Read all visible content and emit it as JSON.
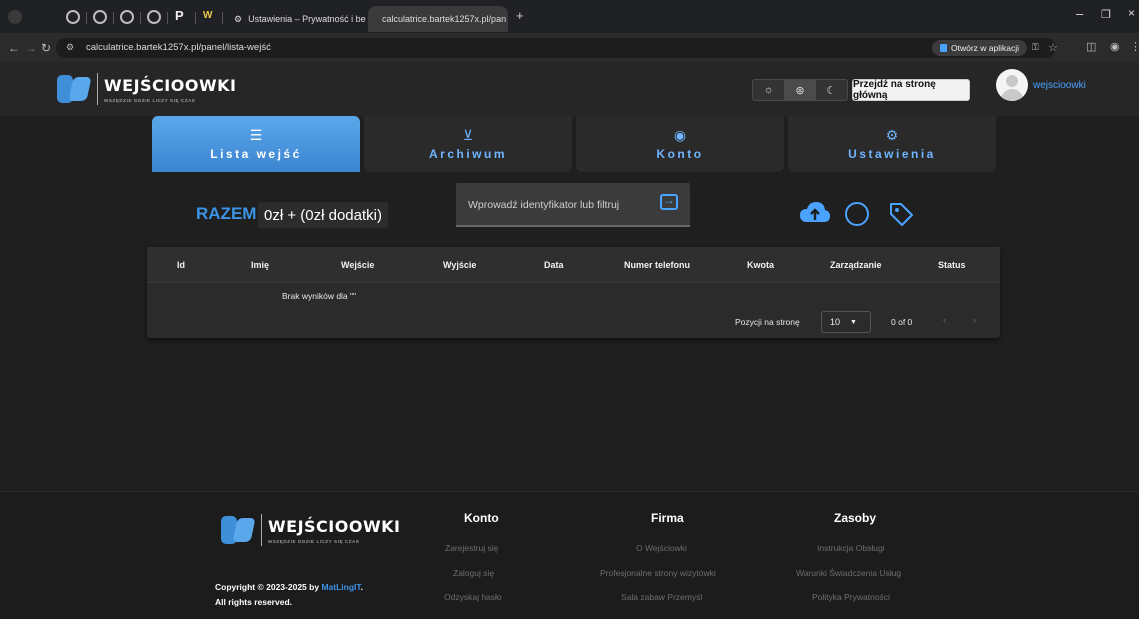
{
  "browser": {
    "tabs": [
      {
        "title": "Ustawienia – Prywatność i bezp",
        "active": false
      },
      {
        "title": "calculatrice.bartek1257x.pl/pan",
        "active": true
      }
    ],
    "url": "calculatrice.bartek1257x.pl/panel/lista-wejść",
    "open_in_app": "Otwórz w aplikacji"
  },
  "header": {
    "logo_title": "WEJŚCIOOWKI",
    "logo_subtitle": "WSZĘDZIE GDZIE LICZY SIĘ CZAS",
    "home_button": "Przejdź na stronę główną",
    "username": "wejscioowki",
    "theme_active": "system"
  },
  "nav_tabs": [
    {
      "label": "Lista wejść",
      "icon": "list-icon",
      "active": true
    },
    {
      "label": "Archiwum",
      "icon": "archive-icon",
      "active": false
    },
    {
      "label": "Konto",
      "icon": "account-icon",
      "active": false
    },
    {
      "label": "Ustawienia",
      "icon": "settings-icon",
      "active": false
    }
  ],
  "summary": {
    "label": "RAZEM:",
    "value": "0zł + (0zł dodatki)"
  },
  "search": {
    "placeholder": "Wprowadź identyfikator lub filtruj"
  },
  "table": {
    "columns": [
      "Id",
      "Imię",
      "Wejście",
      "Wyjście",
      "Data",
      "Numer telefonu",
      "Kwota",
      "Zarządzanie",
      "Status"
    ],
    "empty_message": "Brak wyników dla \"\"",
    "per_page_label": "Pozycji na stronę",
    "per_page_value": "10",
    "range": "0 of 0"
  },
  "footer": {
    "logo_title": "WEJŚCIOOWKI",
    "logo_subtitle": "WSZĘDZIE GDZIE LICZY SIĘ CZAS",
    "copyright_prefix": "Copyright © 2023-2025 by",
    "copyright_brand": "MatLingIT",
    "copyright_suffix": ".",
    "rights": "All rights reserved.",
    "columns": [
      {
        "title": "Konto",
        "links": [
          "Zarejestruj się",
          "Zaloguj się",
          "Odzyskaj hasło"
        ]
      },
      {
        "title": "Firma",
        "links": [
          "O Wejściowki",
          "Profesjonalne strony wizytówki",
          "Sala zabaw Przemyśl"
        ]
      },
      {
        "title": "Zasoby",
        "links": [
          "Instrukcja Obsługi",
          "Warunki Świadczenia Usług",
          "Polityka Prywatności"
        ]
      }
    ]
  }
}
